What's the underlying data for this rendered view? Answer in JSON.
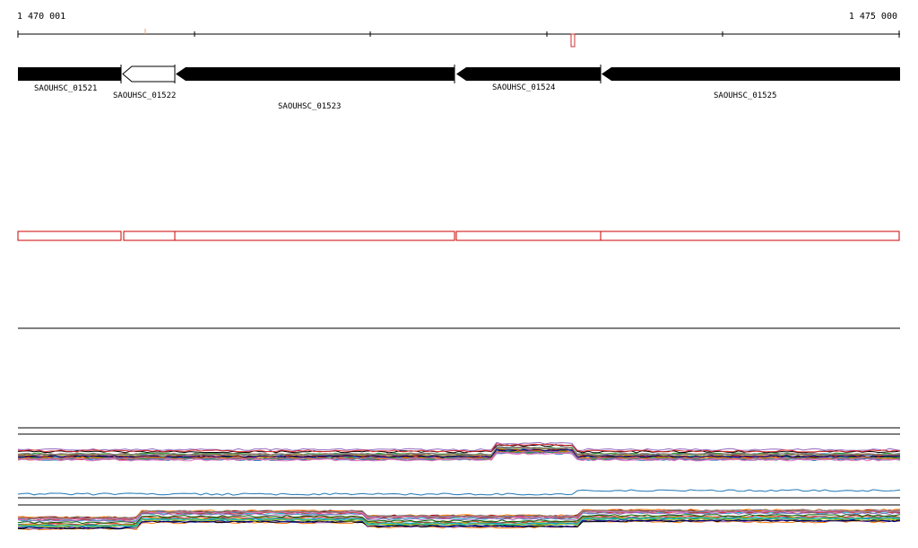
{
  "ruler": {
    "start_label": "1 470 001",
    "end_label": "1 475 000"
  },
  "genes": [
    {
      "id": "SAOUHSC_01521",
      "label": "SAOUHSC_01521",
      "strand": "+",
      "style": "filled"
    },
    {
      "id": "SAOUHSC_01522",
      "label": "SAOUHSC_01522",
      "strand": "-",
      "style": "hollow"
    },
    {
      "id": "SAOUHSC_01523",
      "label": "SAOUHSC_01523",
      "strand": "-",
      "style": "filled"
    },
    {
      "id": "SAOUHSC_01524",
      "label": "SAOUHSC_01524",
      "strand": "-",
      "style": "filled"
    },
    {
      "id": "SAOUHSC_01525",
      "label": "SAOUHSC_01525",
      "strand": "-",
      "style": "filled"
    }
  ],
  "colors": {
    "gene_fill": "#000000",
    "feature_box_stroke": "#cc0000",
    "mark_color": "#cc3333",
    "track_line": "#000000"
  },
  "coverage_palette": [
    "#1f77b4",
    "#d62728",
    "#2ca02c",
    "#ff7f0e",
    "#9467bd",
    "#8c564b",
    "#e377c2",
    "#7f7f7f",
    "#bcbd22",
    "#17becf",
    "#000000",
    "#006400",
    "#8b0000",
    "#00008b"
  ]
}
